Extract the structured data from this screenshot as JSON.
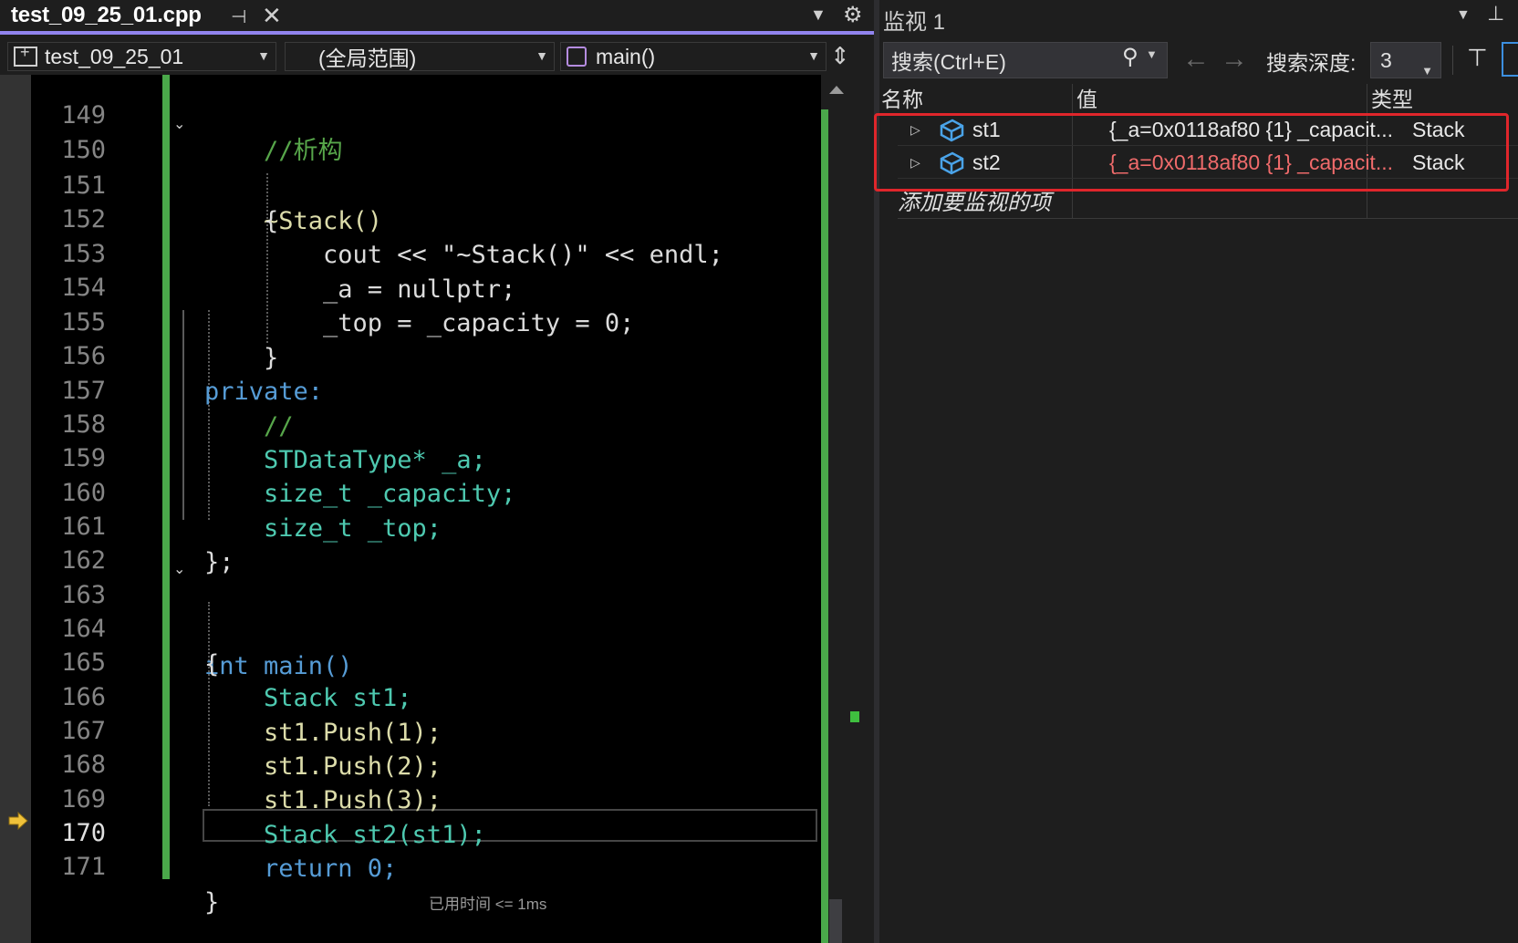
{
  "editor": {
    "tab_title": "test_09_25_01.cpp",
    "nav": {
      "project": "test_09_25_01",
      "scope": "(全局范围)",
      "function": "main()"
    },
    "elapsed_hint": "已用时间 <= 1ms",
    "current_line": "170",
    "lines": [
      {
        "n": "149",
        "code": "//析构"
      },
      {
        "n": "150",
        "code": "~Stack()"
      },
      {
        "n": "151",
        "code": "{"
      },
      {
        "n": "152",
        "code": "cout << \"~Stack()\" << endl;"
      },
      {
        "n": "153",
        "code": "_a = nullptr;"
      },
      {
        "n": "154",
        "code": "_top = _capacity = 0;"
      },
      {
        "n": "155",
        "code": "}"
      },
      {
        "n": "156",
        "code": "private:"
      },
      {
        "n": "157",
        "code": "//"
      },
      {
        "n": "158",
        "code": "STDataType* _a;"
      },
      {
        "n": "159",
        "code": "size_t _capacity;"
      },
      {
        "n": "160",
        "code": "size_t _top;"
      },
      {
        "n": "161",
        "code": "};"
      },
      {
        "n": "162",
        "code": ""
      },
      {
        "n": "163",
        "code": "int main()"
      },
      {
        "n": "164",
        "code": "{"
      },
      {
        "n": "165",
        "code": "Stack st1;"
      },
      {
        "n": "166",
        "code": "st1.Push(1);"
      },
      {
        "n": "167",
        "code": "st1.Push(2);"
      },
      {
        "n": "168",
        "code": "st1.Push(3);"
      },
      {
        "n": "169",
        "code": "Stack st2(st1);"
      },
      {
        "n": "170",
        "code": "return 0;"
      },
      {
        "n": "171",
        "code": "}"
      }
    ]
  },
  "watch": {
    "title": "监视 1",
    "search_placeholder": "搜索(Ctrl+E)",
    "depth_label": "搜索深度:",
    "depth_value": "3",
    "columns": {
      "name": "名称",
      "value": "值",
      "type": "类型"
    },
    "rows": [
      {
        "name": "st1",
        "value": "{_a=0x0118af80 {1} _capacit...",
        "type": "Stack",
        "changed": false
      },
      {
        "name": "st2",
        "value": "{_a=0x0118af80 {1} _capacit...",
        "type": "Stack",
        "changed": true
      }
    ],
    "add_item": "添加要监视的项"
  },
  "colors": {
    "accent_tab": "#9184ee",
    "change_bar": "#4aa84a",
    "highlight_box": "#e0262b",
    "changed_value": "#f06b6b"
  }
}
